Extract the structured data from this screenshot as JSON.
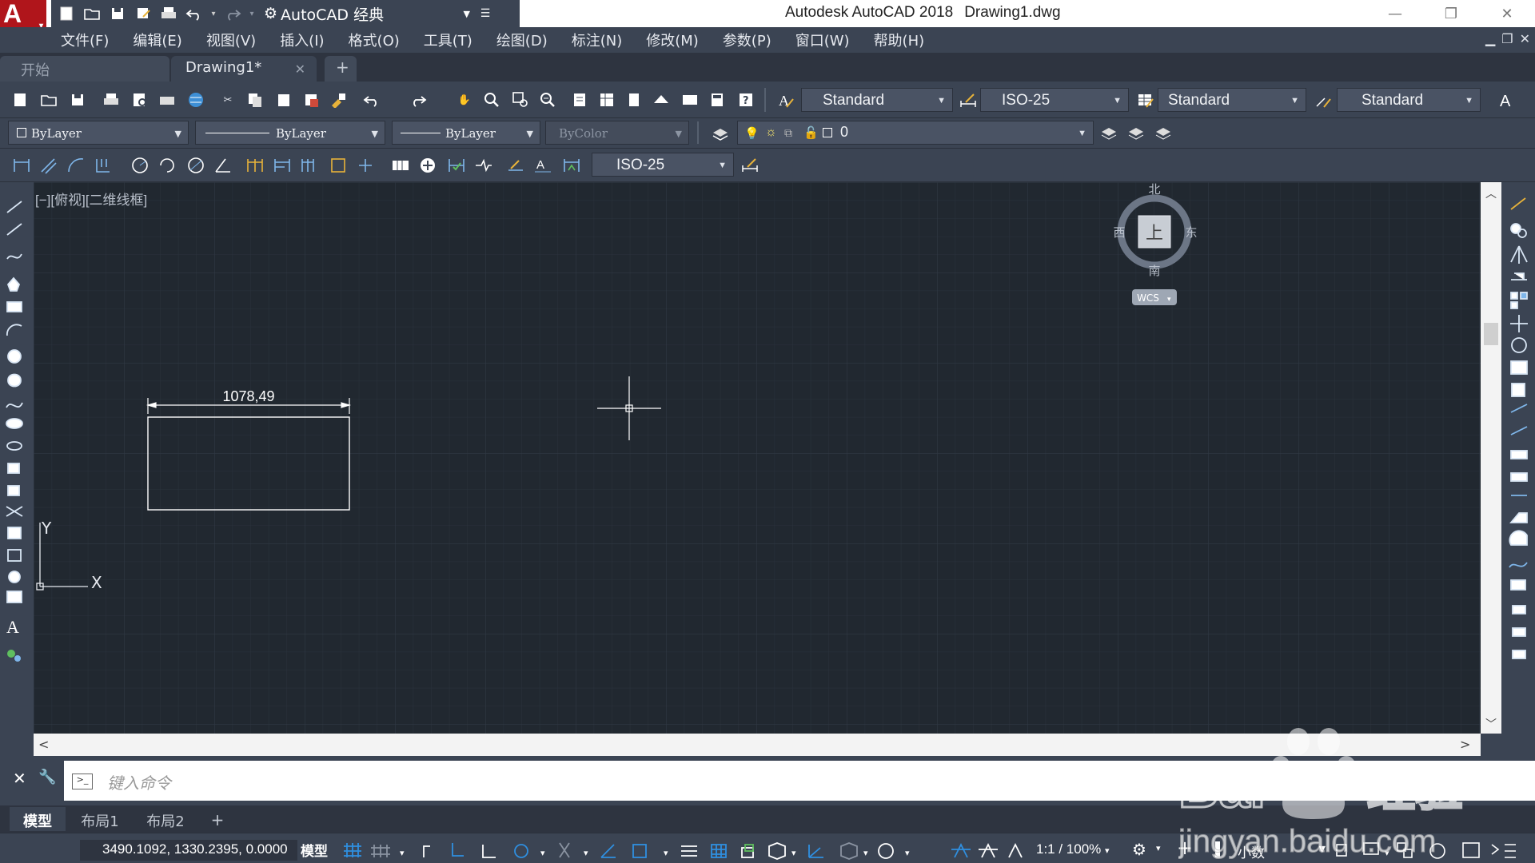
{
  "window": {
    "title": "Autodesk AutoCAD 2018",
    "document": "Drawing1.dwg",
    "workspace": "AutoCAD 经典"
  },
  "menu": [
    "文件(F)",
    "编辑(E)",
    "视图(V)",
    "插入(I)",
    "格式(O)",
    "工具(T)",
    "绘图(D)",
    "标注(N)",
    "修改(M)",
    "参数(P)",
    "窗口(W)",
    "帮助(H)"
  ],
  "file_tabs": {
    "start": "开始",
    "drawing": "Drawing1*",
    "add": "+"
  },
  "styles_toolbar": {
    "text_style": "Standard",
    "dim_style": "ISO-25",
    "table_style": "Standard",
    "multileader_style": "Standard"
  },
  "properties_toolbar": {
    "color": "ByLayer",
    "linetype": "ByLayer",
    "lineweight": "ByLayer",
    "plot_style": "ByColor",
    "layer": "0"
  },
  "dimension_toolbar": {
    "dim_style": "ISO-25"
  },
  "canvas": {
    "view_label": "[−][俯视][二维线框]",
    "dimension_text": "1078,49",
    "ucs_x": "X",
    "ucs_y": "Y",
    "background": "#212830"
  },
  "viewcube": {
    "north": "北",
    "south": "南",
    "east": "东",
    "west": "西",
    "face": "上",
    "wcs": "WCS"
  },
  "command_line": {
    "placeholder": "键入命令"
  },
  "layout_tabs": [
    "模型",
    "布局1",
    "布局2",
    "+"
  ],
  "status_bar": {
    "coordinates": "3490.1092, 1330.2395, 0.0000",
    "model": "模型",
    "scale": "1:1 / 100%",
    "units": "小数"
  },
  "watermark": {
    "brand": "Bai",
    "brand_cn": "经验",
    "url": "jingyan.baidu.com"
  },
  "colors": {
    "accent": "#b0151b",
    "ui_dark": "#3b4453",
    "canvas": "#212830",
    "highlight_blue": "#2f8fe0"
  }
}
